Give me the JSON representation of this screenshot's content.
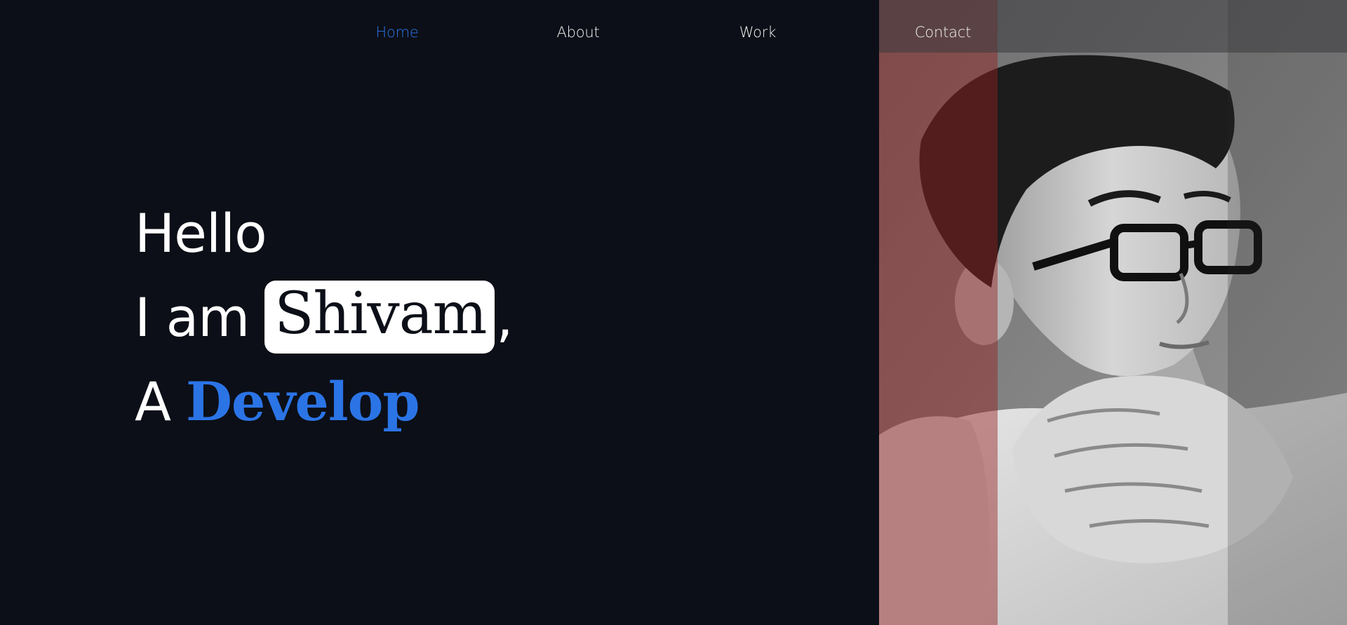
{
  "nav": {
    "items": [
      {
        "label": "Home",
        "active": true
      },
      {
        "label": "About",
        "active": false
      },
      {
        "label": "Work",
        "active": false
      },
      {
        "label": "Contact",
        "active": false
      }
    ]
  },
  "hero": {
    "greeting": "Hello",
    "intro_prefix": "I am",
    "name": "Shivam",
    "name_suffix": ",",
    "role_prefix": "A",
    "role": "Develop"
  },
  "colors": {
    "background": "#0c0f17",
    "accent": "#2b74e6",
    "text": "#ffffff"
  }
}
